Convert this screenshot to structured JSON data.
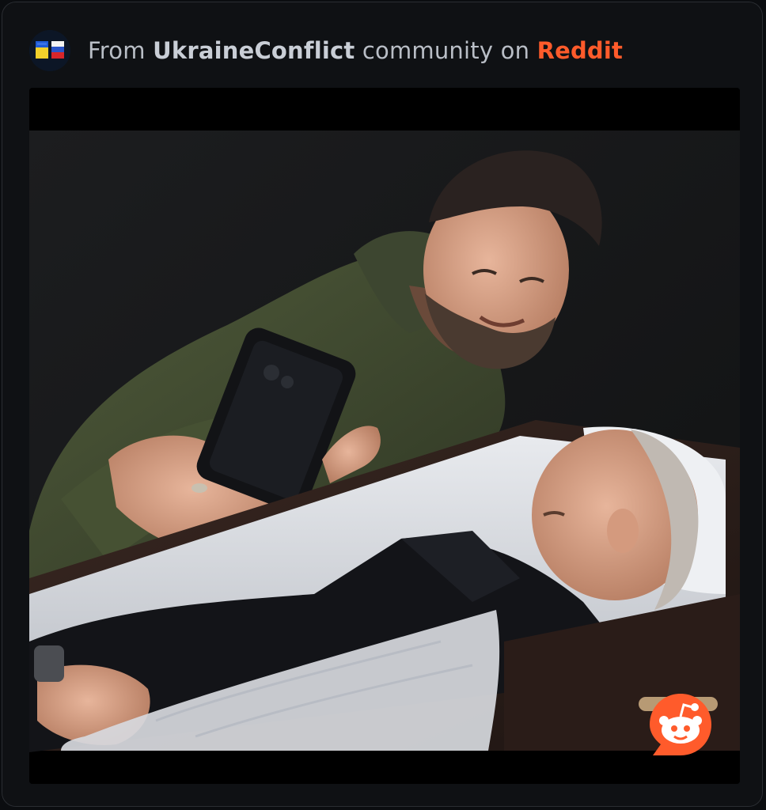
{
  "header": {
    "prefix": "From ",
    "community": "UkraineConflict",
    "middle": " community on ",
    "brand": "Reddit"
  },
  "colors": {
    "brand": "#ff5b2b",
    "card_background": "#0f1114",
    "text_muted": "#b9bec6"
  },
  "media": {
    "description_icon": "photo",
    "watermark_icon": "reddit-snoo-icon"
  }
}
